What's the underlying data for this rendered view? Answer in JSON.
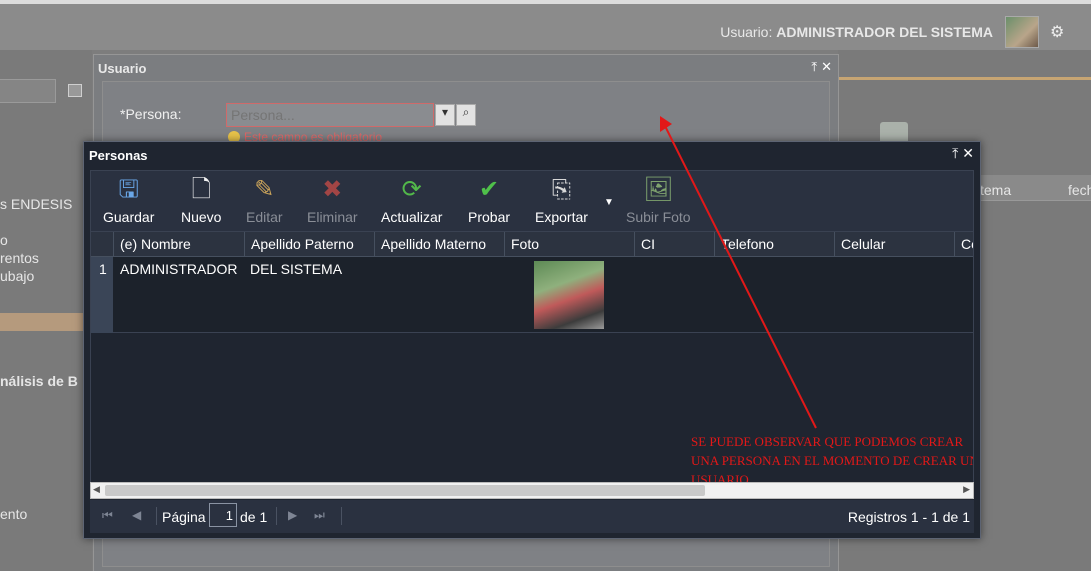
{
  "header": {
    "user_prefix": "Usuario:",
    "user_name": "ADMINISTRADOR DEL SISTEMA"
  },
  "background": {
    "left_texts": [
      "s ENDESIS",
      "o",
      "rentos",
      "ubajo",
      "nálisis de B",
      "ento"
    ],
    "right_texts": [
      "tema",
      "fech"
    ]
  },
  "usuario_window": {
    "title": "Usuario",
    "persona_label": "*Persona:",
    "persona_placeholder": "Persona...",
    "error_text": "Este campo es obligatorio"
  },
  "personas_window": {
    "title": "Personas",
    "toolbar": [
      {
        "label": "Guardar",
        "icon": "save-icon",
        "enabled": true
      },
      {
        "label": "Nuevo",
        "icon": "new-doc-icon",
        "enabled": true
      },
      {
        "label": "Editar",
        "icon": "pencil-icon",
        "enabled": false
      },
      {
        "label": "Eliminar",
        "icon": "delete-icon",
        "enabled": false
      },
      {
        "label": "Actualizar",
        "icon": "refresh-icon",
        "enabled": true
      },
      {
        "label": "Probar",
        "icon": "checkmark-icon",
        "enabled": true
      },
      {
        "label": "Exportar",
        "icon": "export-icon",
        "enabled": true
      },
      {
        "label": "Subir Foto",
        "icon": "upload-photo-icon",
        "enabled": false
      }
    ],
    "columns": [
      "(e) Nombre",
      "Apellido Paterno",
      "Apellido Materno",
      "Foto",
      "CI",
      "Telefono",
      "Celular",
      "Co"
    ],
    "rows": [
      {
        "num": "1",
        "nombre": "ADMINISTRADOR",
        "apellido_paterno": "DEL SISTEMA",
        "apellido_materno": "",
        "ci": "",
        "telefono": "",
        "celular": ""
      }
    ],
    "annotation": "SE PUEDE OBSERVAR QUE PODEMOS CREAR UNA PERSONA EN EL MOMENTO DE CREAR UN USUARIO",
    "pager": {
      "page_label": "Página",
      "page_value": "1",
      "of_label": "de 1",
      "records": "Registros 1 - 1 de 1"
    }
  },
  "colors": {
    "annotation": "#e21818",
    "window_dark": "#1f2530",
    "error": "#d66666"
  }
}
